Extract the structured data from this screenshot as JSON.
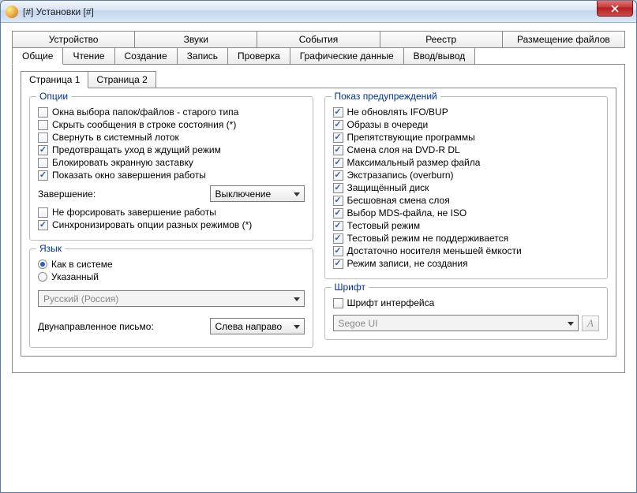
{
  "window": {
    "title": "[#] Установки [#]"
  },
  "topTabs": {
    "row1": [
      "Устройство",
      "Звуки",
      "События",
      "Реестр",
      "Размещение файлов"
    ],
    "row2": [
      "Общие",
      "Чтение",
      "Создание",
      "Запись",
      "Проверка",
      "Графические данные",
      "Ввод/вывод"
    ],
    "row2Active": 0
  },
  "innerTabs": {
    "items": [
      "Страница 1",
      "Страница 2"
    ],
    "active": 0
  },
  "options": {
    "title": "Опции",
    "items": [
      {
        "label": "Окна выбора папок/файлов - старого типа",
        "checked": false
      },
      {
        "label": "Скрыть сообщения в строке состояния (*)",
        "checked": false
      },
      {
        "label": "Свернуть в системный лоток",
        "checked": false
      },
      {
        "label": "Предотвращать уход в ждущий режим",
        "checked": true
      },
      {
        "label": "Блокировать экранную заставку",
        "checked": false
      },
      {
        "label": "Показать окно завершения работы",
        "checked": true
      }
    ],
    "shutdownLabel": "Завершение:",
    "shutdownValue": "Выключение",
    "postItems": [
      {
        "label": "Не форсировать завершение работы",
        "checked": false
      },
      {
        "label": "Синхронизировать опции разных режимов (*)",
        "checked": true
      }
    ]
  },
  "language": {
    "title": "Язык",
    "radios": [
      {
        "label": "Как в системе",
        "checked": true
      },
      {
        "label": "Указанный",
        "checked": false
      }
    ],
    "selected": "Русский (Россия)",
    "bidiLabel": "Двунаправленное письмо:",
    "bidiValue": "Слева направо"
  },
  "warnings": {
    "title": "Показ предупреждений",
    "items": [
      {
        "label": "Не обновлять IFO/BUP",
        "checked": true
      },
      {
        "label": "Образы в очереди",
        "checked": true
      },
      {
        "label": "Препятствующие программы",
        "checked": true
      },
      {
        "label": "Смена слоя на DVD-R DL",
        "checked": true
      },
      {
        "label": "Максимальный размер файла",
        "checked": true
      },
      {
        "label": "Экстразапись (overburn)",
        "checked": true
      },
      {
        "label": "Защищённый диск",
        "checked": true
      },
      {
        "label": "Бесшовная смена слоя",
        "checked": true
      },
      {
        "label": "Выбор MDS-файла, не ISO",
        "checked": true
      },
      {
        "label": "Тестовый режим",
        "checked": true
      },
      {
        "label": "Тестовый режим не поддерживается",
        "checked": true
      },
      {
        "label": "Достаточно носителя меньшей ёмкости",
        "checked": true
      },
      {
        "label": "Режим записи, не создания",
        "checked": true
      }
    ]
  },
  "font": {
    "title": "Шрифт",
    "guiFontLabel": "Шрифт интерфейса",
    "guiFontChecked": false,
    "value": "Segoe UI",
    "button": "A"
  }
}
